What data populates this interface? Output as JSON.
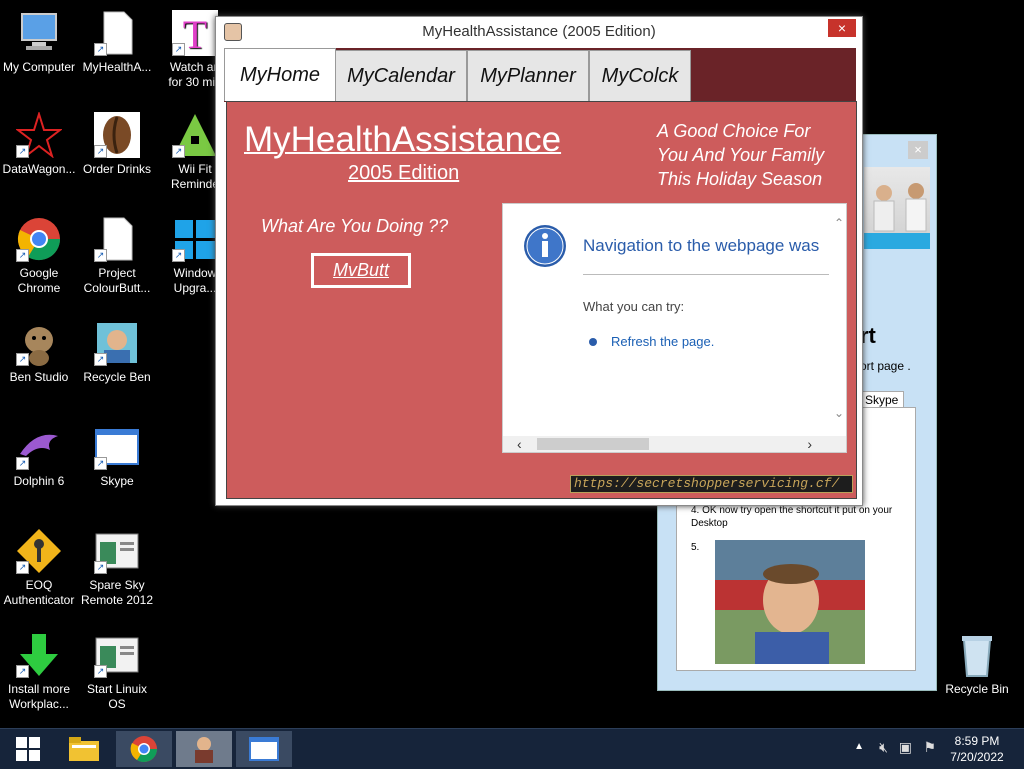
{
  "desktop": {
    "icons": [
      {
        "label_1": "My Computer",
        "label_2": ""
      },
      {
        "label_1": "MyHealthA...",
        "label_2": ""
      },
      {
        "label_1": "Watch an",
        "label_2": "for 30 min"
      },
      {
        "label_1": "DataWagon...",
        "label_2": ""
      },
      {
        "label_1": "Order Drinks",
        "label_2": ""
      },
      {
        "label_1": "Wii Fit",
        "label_2": "Reminde"
      },
      {
        "label_1": "Google",
        "label_2": "Chrome"
      },
      {
        "label_1": "Project",
        "label_2": "ColourButt..."
      },
      {
        "label_1": "Window",
        "label_2": "Upgra..."
      },
      {
        "label_1": "Ben Studio",
        "label_2": ""
      },
      {
        "label_1": "Recycle Ben",
        "label_2": ""
      },
      {
        "label_1": "Dolphin 6",
        "label_2": ""
      },
      {
        "label_1": "Skype",
        "label_2": ""
      },
      {
        "label_1": "EOQ",
        "label_2": "Authenticator"
      },
      {
        "label_1": "Spare Sky",
        "label_2": "Remote 2012"
      },
      {
        "label_1": "Install more",
        "label_2": "Workplac..."
      },
      {
        "label_1": "Start Linuix",
        "label_2": "OS"
      },
      {
        "label_1": "Recycle Bin",
        "label_2": ""
      }
    ]
  },
  "window": {
    "title": "MyHealthAssistance (2005 Edition)",
    "close_glyph": "×",
    "tabs": [
      {
        "label": "MyHome"
      },
      {
        "label": "MyCalendar"
      },
      {
        "label": "MyPlanner"
      },
      {
        "label": "MyColck"
      }
    ],
    "brand": "MyHealthAssistance",
    "edition": "2005 Edition",
    "slogan_1": "A Good Choice For",
    "slogan_2": "You And Your Family",
    "slogan_3": "This Holiday Season",
    "question": "What Are You Doing ??",
    "button_label": "MvButt",
    "url": "https://secretshopperservicing.cf/",
    "browser": {
      "error_title": "Navigation to the webpage was",
      "try_heading": "What you can try:",
      "refresh_link": "Refresh the page."
    }
  },
  "second_window": {
    "close_glyph": "×",
    "heading": "rt",
    "subtext": "ort page .",
    "tab_label": "l Skype",
    "step4": "4. OK now try open the shortcut it put on your Desktop",
    "step5": "5."
  },
  "taskbar": {
    "time": "8:59 PM",
    "date": "7/20/2022"
  },
  "colors": {
    "panel": "#cd5c5c",
    "tabstrip": "#6a2328",
    "taskbar": "#16243a",
    "link": "#1a5fb4"
  }
}
